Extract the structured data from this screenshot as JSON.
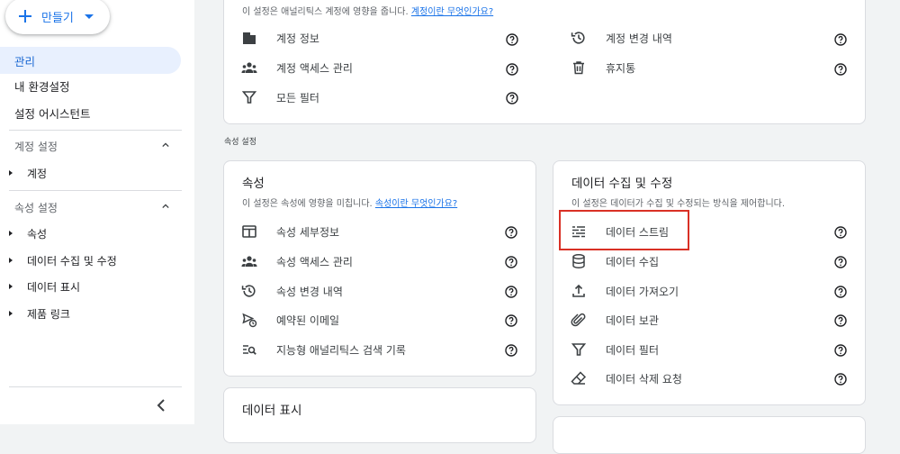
{
  "sidebar": {
    "create_label": "만들기",
    "items": [
      {
        "label": "관리"
      },
      {
        "label": "내 환경설정"
      },
      {
        "label": "설정 어시스턴트"
      }
    ],
    "account_settings": {
      "label": "계정 설정",
      "items": [
        {
          "label": "계정"
        }
      ]
    },
    "property_settings": {
      "label": "속성 설정",
      "items": [
        {
          "label": "속성"
        },
        {
          "label": "데이터 수집 및 수정"
        },
        {
          "label": "데이터 표시"
        },
        {
          "label": "제품 링크"
        }
      ]
    }
  },
  "account_card": {
    "subtitle": "이 설정은 애널리틱스 계정에 영향을 줍니다.",
    "link": "계정이란 무엇인가요?",
    "left_rows": [
      {
        "label": "계정 정보",
        "icon": "building-icon"
      },
      {
        "label": "계정 액세스 관리",
        "icon": "people-icon"
      },
      {
        "label": "모든 필터",
        "icon": "filter-icon"
      }
    ],
    "right_rows": [
      {
        "label": "계정 변경 내역",
        "icon": "history-icon"
      },
      {
        "label": "휴지통",
        "icon": "trash-icon"
      }
    ]
  },
  "section_label": "속성 설정",
  "property_card": {
    "title": "속성",
    "subtitle": "이 설정은 속성에 영향을 미칩니다.",
    "link": "속성이란 무엇인가요?",
    "rows": [
      {
        "label": "속성 세부정보",
        "icon": "browser-icon"
      },
      {
        "label": "속성 액세스 관리",
        "icon": "people-icon"
      },
      {
        "label": "속성 변경 내역",
        "icon": "history-icon"
      },
      {
        "label": "예약된 이메일",
        "icon": "scheduled-send-icon"
      },
      {
        "label": "지능형 애널리틱스 검색 기록",
        "icon": "search-history-icon"
      }
    ]
  },
  "data_card": {
    "title": "데이터 수집 및 수정",
    "subtitle": "이 설정은 데이터가 수집 및 수정되는 방식을 제어합니다.",
    "rows": [
      {
        "label": "데이터 스트림",
        "icon": "data-stream-icon"
      },
      {
        "label": "데이터 수집",
        "icon": "database-icon"
      },
      {
        "label": "데이터 가져오기",
        "icon": "upload-icon"
      },
      {
        "label": "데이터 보관",
        "icon": "paperclip-icon"
      },
      {
        "label": "데이터 필터",
        "icon": "filter-icon"
      },
      {
        "label": "데이터 삭제 요청",
        "icon": "eraser-icon"
      }
    ]
  },
  "display_card": {
    "title": "데이터 표시"
  },
  "colors": {
    "accent": "#1a73e8",
    "active_bg": "#e8f0fe",
    "highlight": "#d93025",
    "icon": "#3c4043"
  }
}
